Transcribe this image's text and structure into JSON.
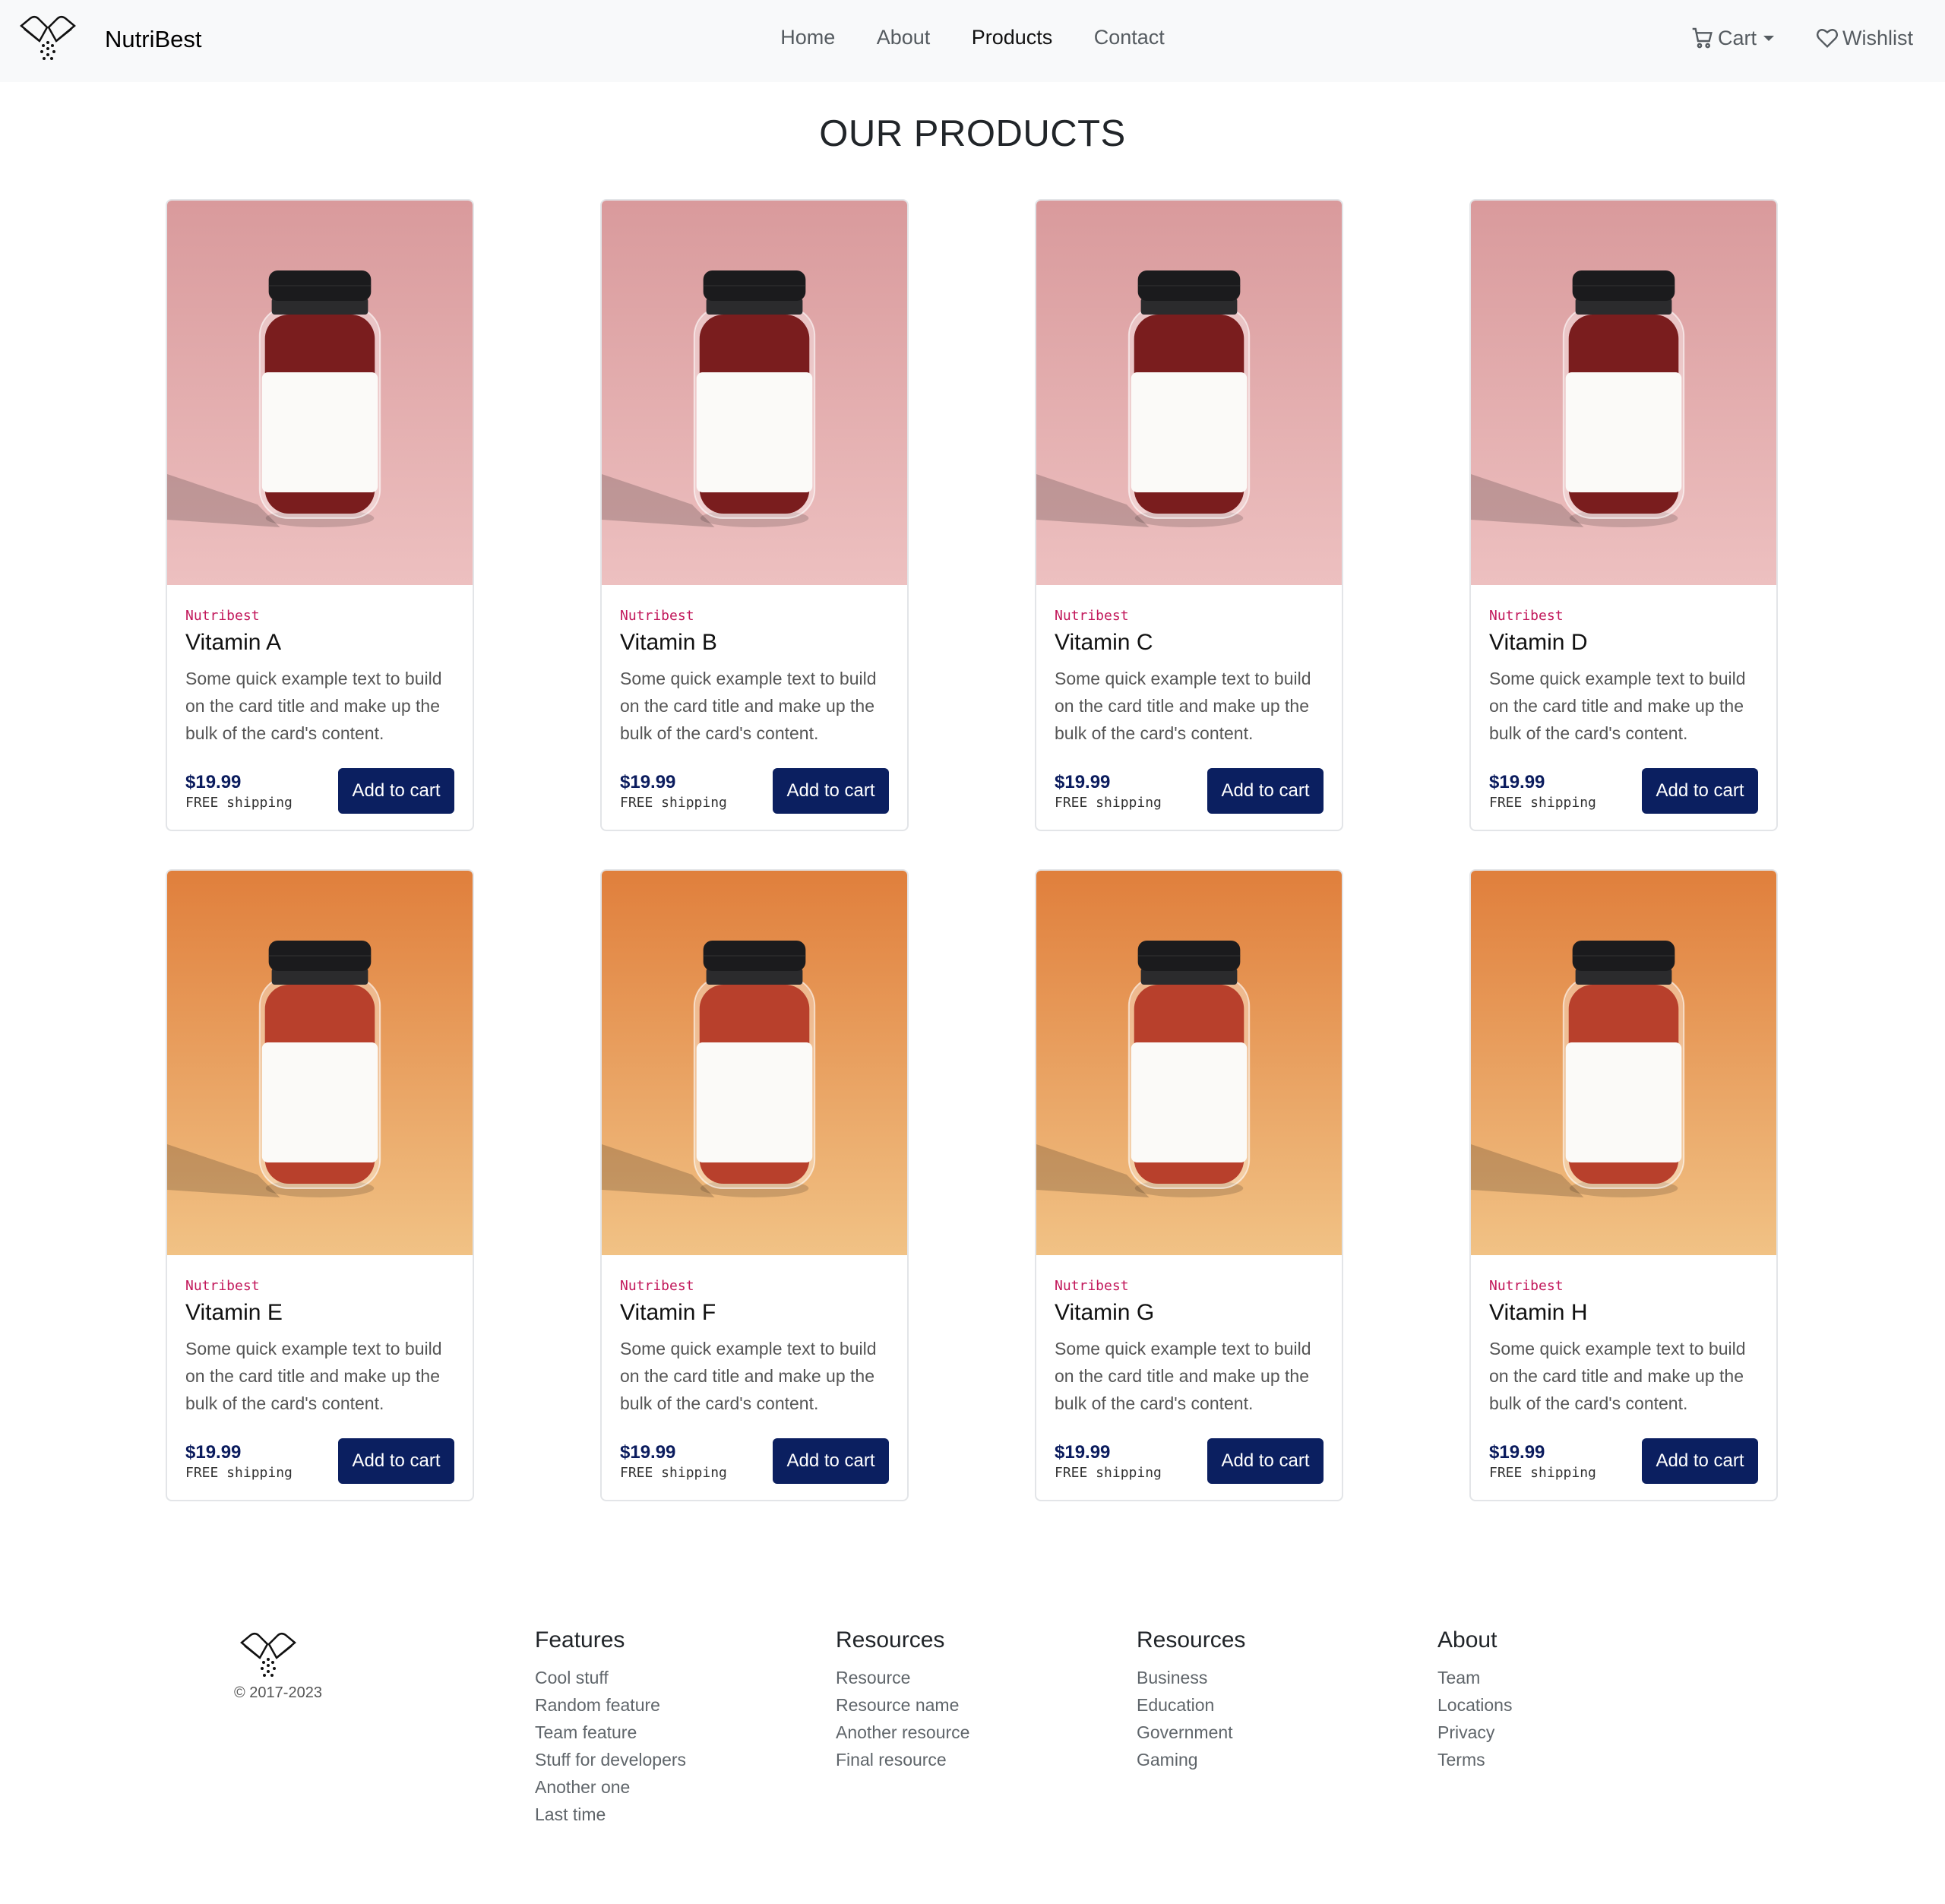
{
  "brand": {
    "name": "NutriBest"
  },
  "nav": {
    "links": [
      "Home",
      "About",
      "Products",
      "Contact"
    ],
    "active": "Products",
    "cart_label": "Cart",
    "wishlist_label": "Wishlist"
  },
  "page_title": "OUR PRODUCTS",
  "products": [
    {
      "brand": "Nutribest",
      "name": "Vitamin A",
      "text": "Some quick example text to build on the card title and make up the bulk of the card's content.",
      "price": "$19.99",
      "shipping": "FREE shipping",
      "button": "Add to cart"
    },
    {
      "brand": "Nutribest",
      "name": "Vitamin B",
      "text": "Some quick example text to build on the card title and make up the bulk of the card's content.",
      "price": "$19.99",
      "shipping": "FREE shipping",
      "button": "Add to cart"
    },
    {
      "brand": "Nutribest",
      "name": "Vitamin C",
      "text": "Some quick example text to build on the card title and make up the bulk of the card's content.",
      "price": "$19.99",
      "shipping": "FREE shipping",
      "button": "Add to cart"
    },
    {
      "brand": "Nutribest",
      "name": "Vitamin D",
      "text": "Some quick example text to build on the card title and make up the bulk of the card's content.",
      "price": "$19.99",
      "shipping": "FREE shipping",
      "button": "Add to cart"
    },
    {
      "brand": "Nutribest",
      "name": "Vitamin E",
      "text": "Some quick example text to build on the card title and make up the bulk of the card's content.",
      "price": "$19.99",
      "shipping": "FREE shipping",
      "button": "Add to cart"
    },
    {
      "brand": "Nutribest",
      "name": "Vitamin F",
      "text": "Some quick example text to build on the card title and make up the bulk of the card's content.",
      "price": "$19.99",
      "shipping": "FREE shipping",
      "button": "Add to cart"
    },
    {
      "brand": "Nutribest",
      "name": "Vitamin G",
      "text": "Some quick example text to build on the card title and make up the bulk of the card's content.",
      "price": "$19.99",
      "shipping": "FREE shipping",
      "button": "Add to cart"
    },
    {
      "brand": "Nutribest",
      "name": "Vitamin H",
      "text": "Some quick example text to build on the card title and make up the bulk of the card's content.",
      "price": "$19.99",
      "shipping": "FREE shipping",
      "button": "Add to cart"
    }
  ],
  "colors": {
    "accent": "#0b1f60",
    "brand_tag": "#c2185b",
    "pink_bg": "#dca5a6",
    "orange_bg": "#e48d45"
  },
  "footer": {
    "copyright": "© 2017-2023",
    "columns": [
      {
        "title": "Features",
        "items": [
          "Cool stuff",
          "Random feature",
          "Team feature",
          "Stuff for developers",
          "Another one",
          "Last time"
        ]
      },
      {
        "title": "Resources",
        "items": [
          "Resource",
          "Resource name",
          "Another resource",
          "Final resource"
        ]
      },
      {
        "title": "Resources",
        "items": [
          "Business",
          "Education",
          "Government",
          "Gaming"
        ]
      },
      {
        "title": "About",
        "items": [
          "Team",
          "Locations",
          "Privacy",
          "Terms"
        ]
      }
    ]
  }
}
